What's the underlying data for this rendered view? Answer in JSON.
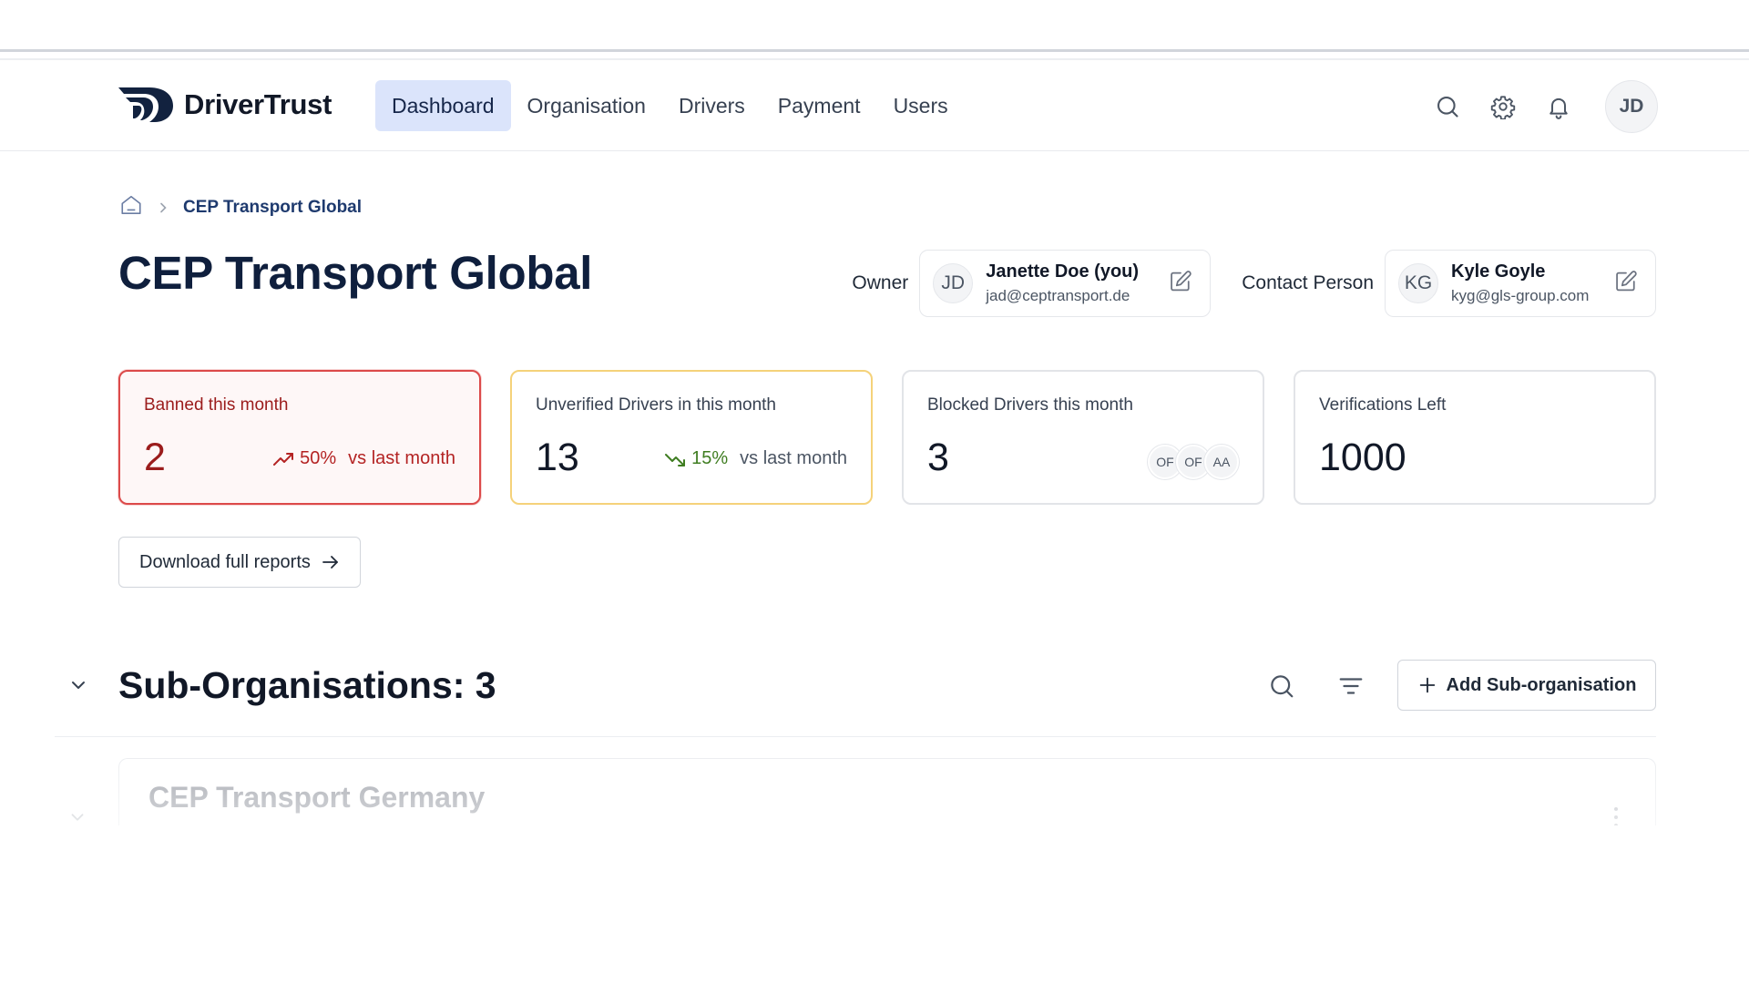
{
  "brand": {
    "name": "DriverTrust"
  },
  "nav": {
    "tabs": [
      {
        "label": "Dashboard",
        "active": true
      },
      {
        "label": "Organisation"
      },
      {
        "label": "Drivers"
      },
      {
        "label": "Payment"
      },
      {
        "label": "Users"
      }
    ],
    "icons": [
      "search-icon",
      "gear-icon",
      "bell-icon"
    ],
    "user_initials": "JD"
  },
  "breadcrumb": {
    "current": "CEP Transport Global"
  },
  "page": {
    "title": "CEP Transport Global"
  },
  "owner": {
    "label": "Owner",
    "initials": "JD",
    "name": "Janette Doe (you)",
    "email": "jad@ceptransport.de"
  },
  "contact": {
    "label": "Contact Person",
    "initials": "KG",
    "name": "Kyle Goyle",
    "email": "kyg@gls-group.com"
  },
  "stats": [
    {
      "label": "Banned this month",
      "value": "2",
      "trend": "up",
      "pct": "50%",
      "compare": "vs last month",
      "accent": "#dc4a4a"
    },
    {
      "label": "Unverified Drivers in this month",
      "value": "13",
      "trend": "down",
      "pct": "15%",
      "compare": "vs last month",
      "accent": "#f5d27a"
    },
    {
      "label": "Blocked Drivers this month",
      "value": "3",
      "avatars": [
        "OF",
        "OF",
        "AA"
      ]
    },
    {
      "label": "Verifications Left",
      "value": "1000"
    }
  ],
  "actions": {
    "download_label": "Download full reports"
  },
  "sub_orgs": {
    "title": "Sub-Organisations: 3",
    "add_label": "Add Sub-organisation",
    "items": [
      {
        "name": "CEP Transport Germany"
      }
    ]
  }
}
